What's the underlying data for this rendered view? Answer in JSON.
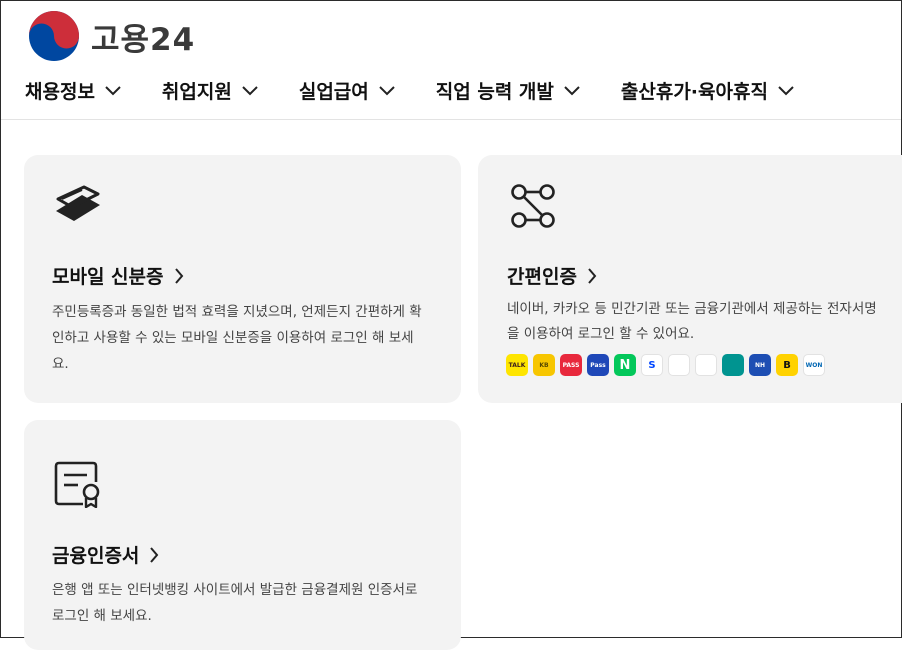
{
  "header": {
    "logo_text": "고용24"
  },
  "nav": [
    {
      "label": "채용정보"
    },
    {
      "label": "취업지원"
    },
    {
      "label": "실업급여"
    },
    {
      "label": "직업 능력 개발"
    },
    {
      "label": "출산휴가·육아휴직"
    }
  ],
  "cards": {
    "mobile_id": {
      "title": "모바일 신분증",
      "desc_line1": "주민등록증과 동일한 법적 효력을 지녔으며, 언제든지 간편하게 확",
      "desc_line2": "인하고 사용할 수 있는 모바일 신분증을 이용하여 로그인 해 보세",
      "desc_line3": "요."
    },
    "simple_auth": {
      "title": "간편인증",
      "desc_line1": "네이버, 카카오 등 민간기관 또는 금융기관에서 제공하는 전자서명",
      "desc_line2": "을 이용하여 로그인 할 수 있어요.",
      "providers": [
        {
          "name": "kakao-talk",
          "label": "TALK",
          "bg": "#fee500",
          "fg": "#3b1e1e"
        },
        {
          "name": "kb",
          "label": "KB",
          "bg": "#f7c600",
          "fg": "#5a4a00"
        },
        {
          "name": "pass",
          "label": "PASS",
          "bg": "#e8283c",
          "fg": "#ffffff"
        },
        {
          "name": "samsung-pass",
          "label": "Pass",
          "bg": "#1f48b8",
          "fg": "#ffffff"
        },
        {
          "name": "naver",
          "label": "N",
          "bg": "#03c75a",
          "fg": "#ffffff"
        },
        {
          "name": "shinhan",
          "label": "S",
          "bg": "#ffffff",
          "fg": "#0046ff"
        },
        {
          "name": "toss",
          "label": "",
          "bg": "#ffffff",
          "fg": "#0064ff"
        },
        {
          "name": "hana",
          "label": "",
          "bg": "#ffffff",
          "fg": "#00a59a"
        },
        {
          "name": "hana-bank",
          "label": "",
          "bg": "#009490",
          "fg": "#ffffff"
        },
        {
          "name": "nh",
          "label": "NH",
          "bg": "#1d4eb3",
          "fg": "#ffffff"
        },
        {
          "name": "banksalad",
          "label": "B",
          "bg": "#ffd200",
          "fg": "#111111"
        },
        {
          "name": "woori-won",
          "label": "WON",
          "bg": "#ffffff",
          "fg": "#0066b3"
        }
      ]
    },
    "financial_cert": {
      "title": "금융인증서",
      "desc_line1": "은행 앱 또는 인터넷뱅킹 사이트에서 발급한 금융결제원 인증서로",
      "desc_line2": "로그인 해 보세요."
    }
  }
}
